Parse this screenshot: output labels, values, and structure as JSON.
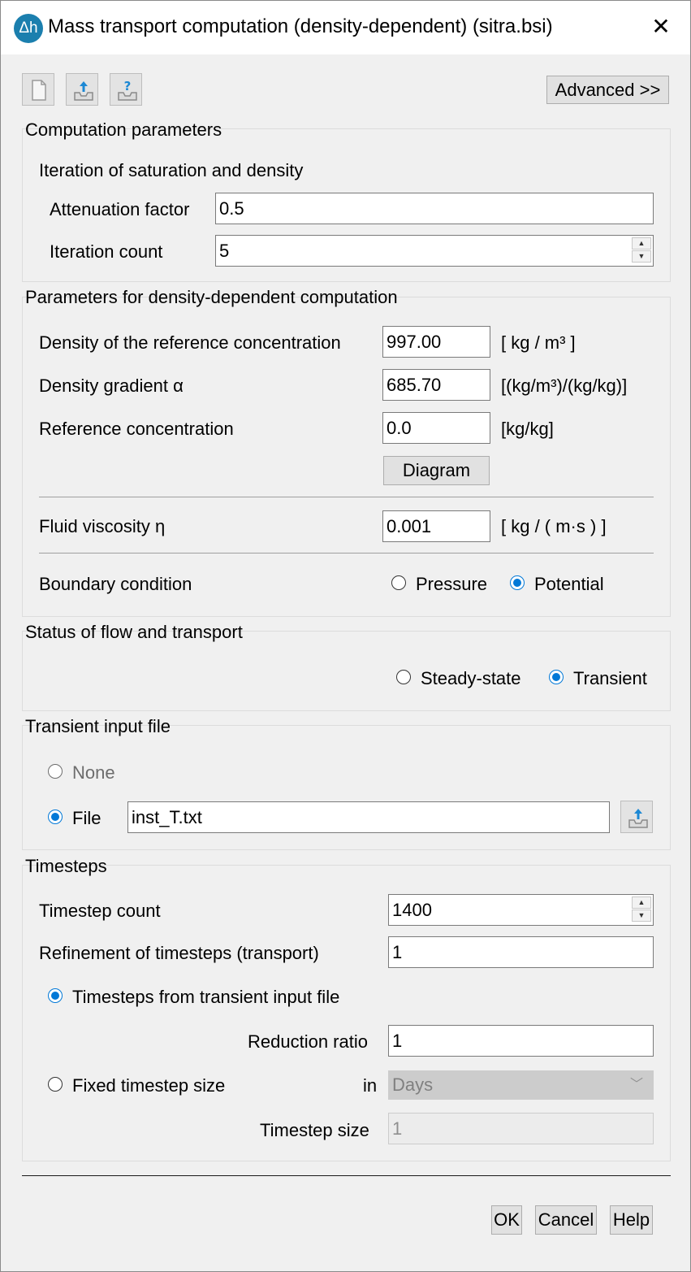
{
  "window": {
    "app_icon_text": "Δh",
    "title": "Mass transport computation (density-dependent) (sitra.bsi)",
    "close_glyph": "✕"
  },
  "toolbar": {
    "icons": [
      "new-file-icon",
      "load-icon",
      "help-load-icon"
    ],
    "advanced_label": "Advanced >>"
  },
  "computation": {
    "title": "Computation parameters",
    "subtitle": "Iteration of saturation and density",
    "attenuation_label": "Attenuation factor",
    "attenuation_value": "0.5",
    "iteration_label": "Iteration count",
    "iteration_value": "5"
  },
  "density": {
    "title": "Parameters for density-dependent computation",
    "ref_density_label": "Density of the reference concentration",
    "ref_density_value": "997.00",
    "ref_density_unit": "[ kg / m³ ]",
    "gradient_label": "Density gradient α",
    "gradient_value": "685.70",
    "gradient_unit": "[(kg/m³)/(kg/kg)]",
    "ref_conc_label": "Reference concentration",
    "ref_conc_value": "0.0",
    "ref_conc_unit": "[kg/kg]",
    "diagram_label": "Diagram",
    "viscosity_label": "Fluid viscosity η",
    "viscosity_value": "0.001",
    "viscosity_unit": "[ kg / ( m·s ) ]",
    "boundary_label": "Boundary condition",
    "boundary_options": [
      "Pressure",
      "Potential"
    ],
    "boundary_selected": "Potential"
  },
  "status": {
    "title": "Status of flow and transport",
    "options": [
      "Steady-state",
      "Transient"
    ],
    "selected": "Transient"
  },
  "transient_file": {
    "title": "Transient input file",
    "none_label": "None",
    "file_label": "File",
    "selected": "File",
    "file_value": "inst_T.txt"
  },
  "timesteps": {
    "title": "Timesteps",
    "count_label": "Timestep count",
    "count_value": "1400",
    "refinement_label": "Refinement of timesteps (transport)",
    "refinement_value": "1",
    "from_file_label": "Timesteps from transient input file",
    "reduction_label": "Reduction ratio",
    "reduction_value": "1",
    "fixed_label": "Fixed timestep size",
    "in_label": "in",
    "unit_selected": "Days",
    "size_label": "Timestep size",
    "size_value": "1",
    "selected": "Timesteps from transient input file"
  },
  "footer": {
    "ok_label": "OK",
    "cancel_label": "Cancel",
    "help_label": "Help"
  },
  "colors": {
    "accent": "#0078d7",
    "app_icon": "#1b7fae",
    "dialog_background": "#f0f0f0"
  }
}
